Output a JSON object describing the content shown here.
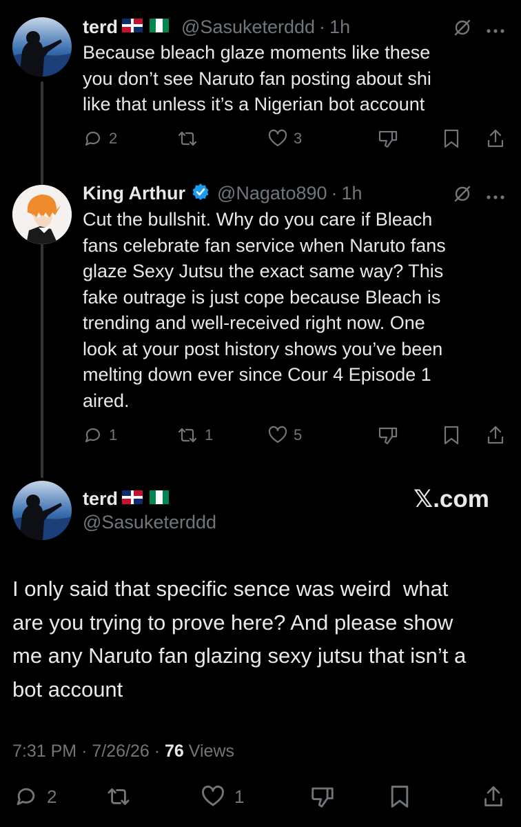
{
  "tweet1": {
    "display_name": "terd",
    "flags": [
      "dominican-republic-flag",
      "nigeria-flag"
    ],
    "handle": "@Sasuketerddd",
    "time": "1h",
    "lines": [
      "Because bleach glaze moments like these",
      "you don’t see Naruto fan posting about shi",
      "like that unless it’s a Nigerian bot account"
    ],
    "replies": "2",
    "reposts": "",
    "likes": "3"
  },
  "tweet2": {
    "display_name": "King Arthur",
    "verified": true,
    "handle": "@Nagato890",
    "time": "1h",
    "lines": [
      "Cut the bullshit. Why do you care if Bleach",
      "fans celebrate fan service when Naruto fans",
      "glaze Sexy Jutsu the exact same way? This",
      "fake outrage is just cope because Bleach is",
      "trending and well-received right now. One",
      "look at your post history shows you’ve been",
      "melting down ever since Cour 4 Episode 1",
      "aired."
    ],
    "replies": "1",
    "reposts": "1",
    "likes": "5"
  },
  "main_tweet": {
    "display_name": "terd",
    "flags": [
      "dominican-republic-flag",
      "nigeria-flag"
    ],
    "handle": "@Sasuketerddd",
    "watermark": "𝕏.com",
    "lines": [
      "I only said that specific sence was weird  what",
      "are you trying to prove here? And please show",
      "me any Naruto fan glazing sexy jutsu that isn’t a",
      "bot account"
    ],
    "time": "7:31 PM",
    "date": "7/26/26",
    "views_count": "76",
    "views_label": "Views",
    "replies": "2",
    "likes": "1"
  },
  "separator": "·",
  "colors": {
    "background": "#000000",
    "text": "#e7e9ea",
    "secondary": "#71767b",
    "verified": "#1d9bf0"
  }
}
